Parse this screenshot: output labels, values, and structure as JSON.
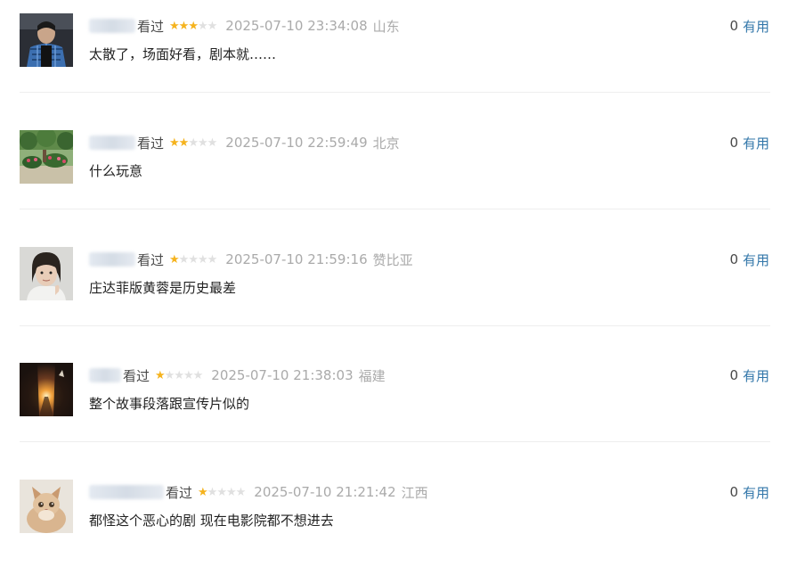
{
  "comments": [
    {
      "avatar": "person-in-blue-plaid-shirt",
      "status": "看过",
      "rating": 3,
      "time": "2025-07-10 23:34:08",
      "location": "山东",
      "content": "太散了，场面好看，剧本就……",
      "votes": "0",
      "vote_label": "有用"
    },
    {
      "avatar": "garden-with-flowers",
      "status": "看过",
      "rating": 2,
      "time": "2025-07-10 22:59:49",
      "location": "北京",
      "content": "什么玩意",
      "votes": "0",
      "vote_label": "有用"
    },
    {
      "avatar": "person-portrait",
      "status": "看过",
      "rating": 1,
      "time": "2025-07-10 21:59:16",
      "location": "赞比亚",
      "content": "庄达菲版黄蓉是历史最差",
      "votes": "0",
      "vote_label": "有用"
    },
    {
      "avatar": "sunset-between-buildings",
      "status": "看过",
      "rating": 1,
      "time": "2025-07-10 21:38:03",
      "location": "福建",
      "content": "整个故事段落跟宣传片似的",
      "votes": "0",
      "vote_label": "有用"
    },
    {
      "avatar": "fluffy-kitten",
      "status": "看过",
      "rating": 1,
      "time": "2025-07-10 21:21:42",
      "location": "江西",
      "content": "都怪这个恶心的剧 现在电影院都不想进去",
      "votes": "0",
      "vote_label": "有用"
    }
  ],
  "colors": {
    "link": "#3377aa",
    "star_on": "#f5b31d",
    "star_off": "#e0e0e0",
    "meta_text": "#aaaaaa",
    "body_text": "#222222",
    "divider": "#eeeeee"
  }
}
